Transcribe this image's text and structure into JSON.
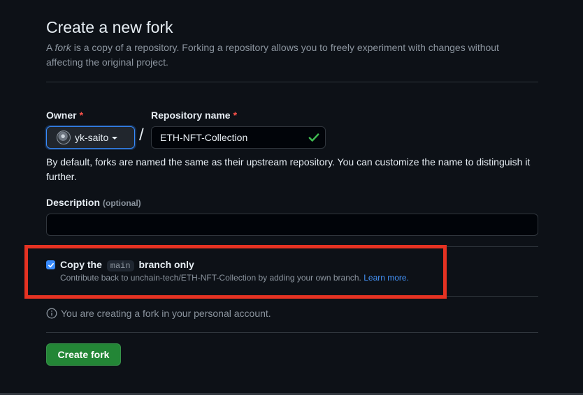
{
  "header": {
    "title": "Create a new fork",
    "subtitle_prefix": "A ",
    "subtitle_em": "fork",
    "subtitle_rest": " is a copy of a repository. Forking a repository allows you to freely experiment with changes without affecting the original project."
  },
  "owner": {
    "label": "Owner",
    "required_mark": "*",
    "value": "yk-saito"
  },
  "repository": {
    "label": "Repository name",
    "required_mark": "*",
    "value": "ETH-NFT-Collection",
    "valid": true
  },
  "name_help": "By default, forks are named the same as their upstream repository. You can customize the name to distinguish it further.",
  "description": {
    "label": "Description",
    "optional": "(optional)",
    "value": ""
  },
  "copy_branch": {
    "checked": true,
    "label_before": "Copy the",
    "branch": "main",
    "label_after": "branch only",
    "note": "Contribute back to unchain-tech/ETH-NFT-Collection by adding your own branch.",
    "learn_more": "Learn more."
  },
  "info": {
    "text": "You are creating a fork in your personal account."
  },
  "actions": {
    "create_label": "Create fork"
  },
  "colors": {
    "background": "#0d1117",
    "accent_blue": "#388bfd",
    "success_green": "#238636",
    "required_red": "#f85149",
    "highlight_red": "#e53222"
  }
}
